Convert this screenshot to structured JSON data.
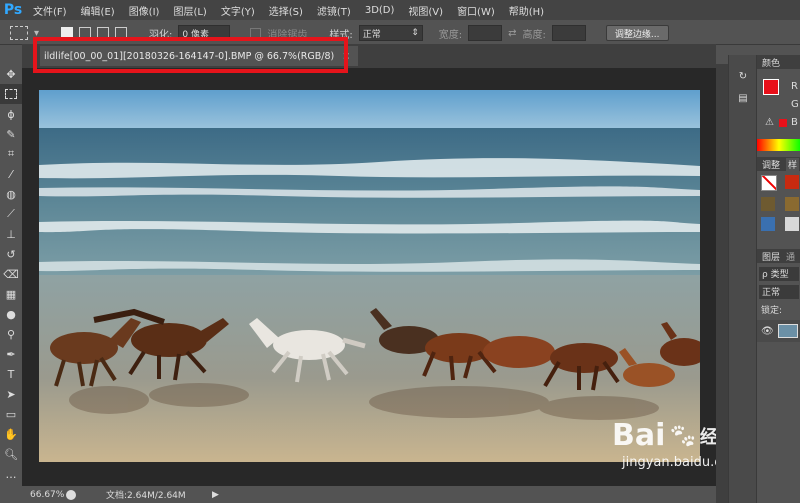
{
  "app": {
    "logo": "Ps"
  },
  "menu": [
    "文件(F)",
    "编辑(E)",
    "图像(I)",
    "图层(L)",
    "文字(Y)",
    "选择(S)",
    "滤镜(T)",
    "3D(D)",
    "视图(V)",
    "窗口(W)",
    "帮助(H)"
  ],
  "options": {
    "feather_label": "羽化:",
    "feather_value": "0 像素",
    "antialias_label": "消除锯齿",
    "style_label": "样式:",
    "style_value": "正常",
    "width_label": "宽度:",
    "height_label": "高度:",
    "refine_button": "调整边缘..."
  },
  "document": {
    "tab_title": "ildlife[00_00_01][20180326-164147-0].BMP @ 66.7%(RGB/8)",
    "close": "×"
  },
  "status": {
    "zoom": "66.67%",
    "doc_info": "文档:2.64M/2.64M"
  },
  "panels": {
    "color_tab": "颜色",
    "color_r": "R",
    "color_g": "G",
    "color_b": "B",
    "adjust_tab": "调整",
    "style_tab": "样",
    "layers_tab": "图层",
    "channels_tab": "通",
    "kind_label": "ρ 类型",
    "blend_mode": "正常",
    "lock_label": "锁定:"
  },
  "watermark": {
    "brand": "Bai",
    "brand_tail": "经验",
    "url": "jingyan.baidu.com"
  },
  "colors": {
    "foreground": "#e8101a",
    "highlight_box": "#e5141b"
  }
}
